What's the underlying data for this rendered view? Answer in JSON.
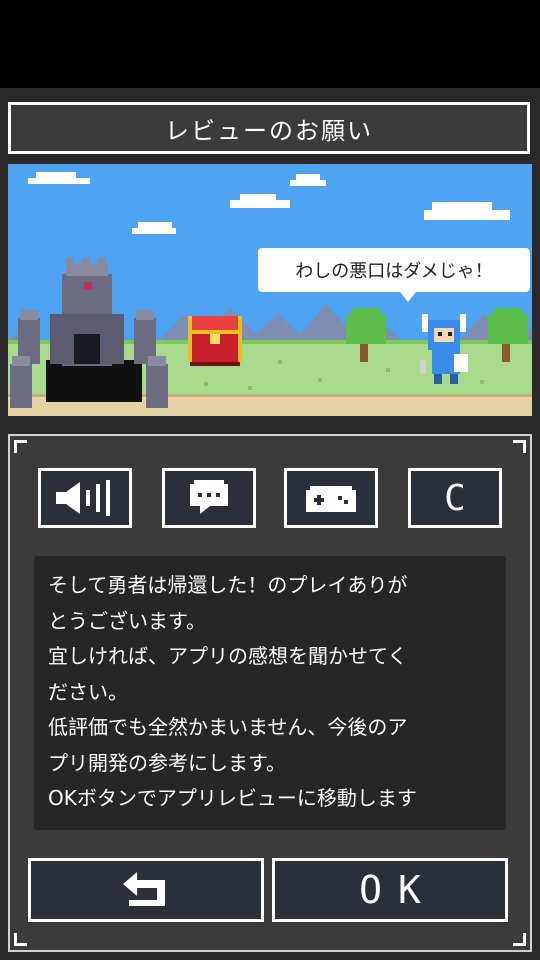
{
  "dialog": {
    "title": "レビューのお願い"
  },
  "scene": {
    "speech_text": "わしの悪口はダメじゃ！"
  },
  "toolbar": {
    "sound_icon": "speaker-icon",
    "chat_icon": "speech-bubble-icon",
    "controller_icon": "gamepad-icon",
    "credit_label": "C"
  },
  "message": {
    "lines": [
      "そして勇者は帰還した！のプレイありが",
      "とうございます。",
      "宜しければ、アプリの感想を聞かせてく",
      "ださい。",
      "低評価でも全然かまいません、今後のア",
      "プリ開発の参考にします。",
      "OKボタンでアプリレビューに移動します"
    ]
  },
  "actions": {
    "back_icon": "back-arrow-icon",
    "ok_label": "OK"
  }
}
